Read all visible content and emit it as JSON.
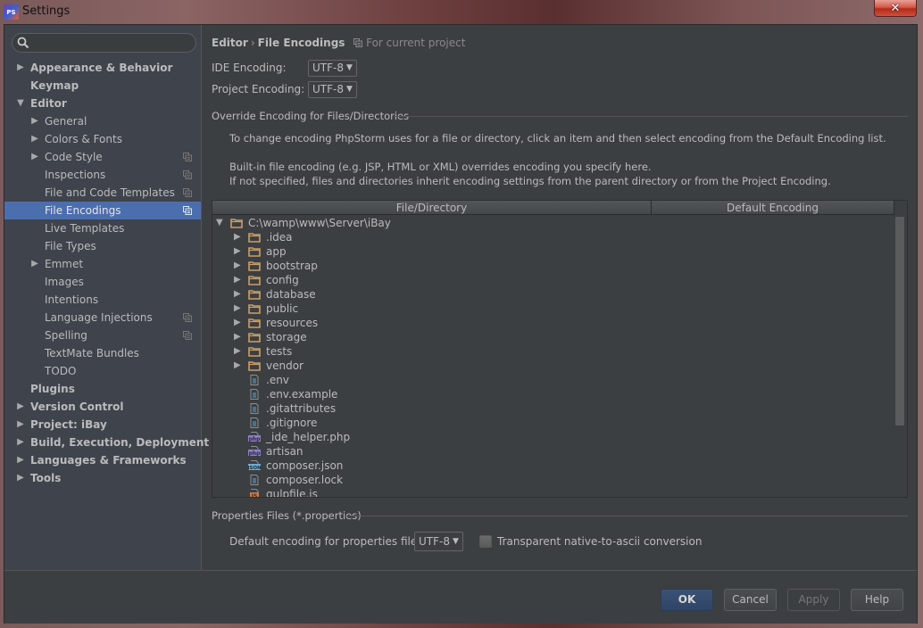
{
  "window": {
    "title": "Settings",
    "app_icon_text": "PS",
    "close_glyph": "✕"
  },
  "search": {
    "placeholder": "",
    "value": ""
  },
  "sidebar": {
    "items": [
      {
        "label": "Appearance & Behavior",
        "level": 0,
        "bold": true,
        "arrow": "▶",
        "project": false,
        "selected": false
      },
      {
        "label": "Keymap",
        "level": 0,
        "bold": true,
        "arrow": "",
        "project": false,
        "selected": false
      },
      {
        "label": "Editor",
        "level": 0,
        "bold": true,
        "arrow": "▼",
        "project": false,
        "selected": false
      },
      {
        "label": "General",
        "level": 1,
        "bold": false,
        "arrow": "▶",
        "project": false,
        "selected": false
      },
      {
        "label": "Colors & Fonts",
        "level": 1,
        "bold": false,
        "arrow": "▶",
        "project": false,
        "selected": false
      },
      {
        "label": "Code Style",
        "level": 1,
        "bold": false,
        "arrow": "▶",
        "project": true,
        "selected": false
      },
      {
        "label": "Inspections",
        "level": 1,
        "bold": false,
        "arrow": "",
        "project": true,
        "selected": false
      },
      {
        "label": "File and Code Templates",
        "level": 1,
        "bold": false,
        "arrow": "",
        "project": true,
        "selected": false
      },
      {
        "label": "File Encodings",
        "level": 1,
        "bold": false,
        "arrow": "",
        "project": true,
        "selected": true
      },
      {
        "label": "Live Templates",
        "level": 1,
        "bold": false,
        "arrow": "",
        "project": false,
        "selected": false
      },
      {
        "label": "File Types",
        "level": 1,
        "bold": false,
        "arrow": "",
        "project": false,
        "selected": false
      },
      {
        "label": "Emmet",
        "level": 1,
        "bold": false,
        "arrow": "▶",
        "project": false,
        "selected": false
      },
      {
        "label": "Images",
        "level": 1,
        "bold": false,
        "arrow": "",
        "project": false,
        "selected": false
      },
      {
        "label": "Intentions",
        "level": 1,
        "bold": false,
        "arrow": "",
        "project": false,
        "selected": false
      },
      {
        "label": "Language Injections",
        "level": 1,
        "bold": false,
        "arrow": "",
        "project": true,
        "selected": false
      },
      {
        "label": "Spelling",
        "level": 1,
        "bold": false,
        "arrow": "",
        "project": true,
        "selected": false
      },
      {
        "label": "TextMate Bundles",
        "level": 1,
        "bold": false,
        "arrow": "",
        "project": false,
        "selected": false
      },
      {
        "label": "TODO",
        "level": 1,
        "bold": false,
        "arrow": "",
        "project": false,
        "selected": false
      },
      {
        "label": "Plugins",
        "level": 0,
        "bold": true,
        "arrow": "",
        "project": false,
        "selected": false
      },
      {
        "label": "Version Control",
        "level": 0,
        "bold": true,
        "arrow": "▶",
        "project": false,
        "selected": false
      },
      {
        "label": "Project: iBay",
        "level": 0,
        "bold": true,
        "arrow": "▶",
        "project": false,
        "selected": false
      },
      {
        "label": "Build, Execution, Deployment",
        "level": 0,
        "bold": true,
        "arrow": "▶",
        "project": false,
        "selected": false
      },
      {
        "label": "Languages & Frameworks",
        "level": 0,
        "bold": true,
        "arrow": "▶",
        "project": false,
        "selected": false
      },
      {
        "label": "Tools",
        "level": 0,
        "bold": true,
        "arrow": "▶",
        "project": false,
        "selected": false
      }
    ]
  },
  "main": {
    "breadcrumb": {
      "parent": "Editor",
      "separator": "›",
      "current": "File Encodings",
      "note": "For current project"
    },
    "ide_encoding": {
      "label": "IDE Encoding:",
      "value": "UTF-8"
    },
    "project_encoding": {
      "label": "Project Encoding:",
      "value": "UTF-8"
    },
    "override_group": {
      "title": "Override Encoding for Files/Directories",
      "desc1": "To change encoding PhpStorm uses for a file or directory, click an item and then select encoding from the Default Encoding list.",
      "desc2": "Built-in file encoding (e.g. JSP, HTML or XML) overrides encoding you specify here.",
      "desc3": "If not specified, files and directories inherit encoding settings from the parent directory or from the Project Encoding."
    },
    "table": {
      "columns": [
        "File/Directory",
        "Default Encoding"
      ],
      "rows": [
        {
          "name": "C:\\wamp\\www\\Server\\iBay",
          "depth": 0,
          "arrow": "▼",
          "type": "folder",
          "encoding": ""
        },
        {
          "name": ".idea",
          "depth": 1,
          "arrow": "▶",
          "type": "folder",
          "encoding": ""
        },
        {
          "name": "app",
          "depth": 1,
          "arrow": "▶",
          "type": "folder",
          "encoding": ""
        },
        {
          "name": "bootstrap",
          "depth": 1,
          "arrow": "▶",
          "type": "folder",
          "encoding": ""
        },
        {
          "name": "config",
          "depth": 1,
          "arrow": "▶",
          "type": "folder",
          "encoding": ""
        },
        {
          "name": "database",
          "depth": 1,
          "arrow": "▶",
          "type": "folder",
          "encoding": ""
        },
        {
          "name": "public",
          "depth": 1,
          "arrow": "▶",
          "type": "folder",
          "encoding": ""
        },
        {
          "name": "resources",
          "depth": 1,
          "arrow": "▶",
          "type": "folder",
          "encoding": ""
        },
        {
          "name": "storage",
          "depth": 1,
          "arrow": "▶",
          "type": "folder",
          "encoding": ""
        },
        {
          "name": "tests",
          "depth": 1,
          "arrow": "▶",
          "type": "folder",
          "encoding": ""
        },
        {
          "name": "vendor",
          "depth": 1,
          "arrow": "▶",
          "type": "folder",
          "encoding": ""
        },
        {
          "name": ".env",
          "depth": 1,
          "arrow": "",
          "type": "text",
          "encoding": ""
        },
        {
          "name": ".env.example",
          "depth": 1,
          "arrow": "",
          "type": "text",
          "encoding": ""
        },
        {
          "name": ".gitattributes",
          "depth": 1,
          "arrow": "",
          "type": "text",
          "encoding": ""
        },
        {
          "name": ".gitignore",
          "depth": 1,
          "arrow": "",
          "type": "text",
          "encoding": ""
        },
        {
          "name": "_ide_helper.php",
          "depth": 1,
          "arrow": "",
          "type": "php",
          "encoding": ""
        },
        {
          "name": "artisan",
          "depth": 1,
          "arrow": "",
          "type": "php",
          "encoding": ""
        },
        {
          "name": "composer.json",
          "depth": 1,
          "arrow": "",
          "type": "json",
          "encoding": ""
        },
        {
          "name": "composer.lock",
          "depth": 1,
          "arrow": "",
          "type": "text",
          "encoding": ""
        },
        {
          "name": "gulpfile.js",
          "depth": 1,
          "arrow": "",
          "type": "js",
          "encoding": ""
        }
      ],
      "scroll_fraction_visible": 0.75
    },
    "properties_group": {
      "title": "Properties Files (*.properties)",
      "default_label": "Default encoding for properties files:",
      "default_value": "UTF-8",
      "checkbox_label": "Transparent native-to-ascii conversion",
      "checkbox_checked": false
    }
  },
  "footer": {
    "ok": "OK",
    "cancel": "Cancel",
    "apply": "Apply",
    "help": "Help"
  },
  "colors": {
    "selection": "#4b6eaf",
    "folder": "#c89f6a",
    "php": "#8f7fd0",
    "json": "#6aaed6",
    "js": "#d67a3c",
    "text_file": "#8a8e92"
  }
}
